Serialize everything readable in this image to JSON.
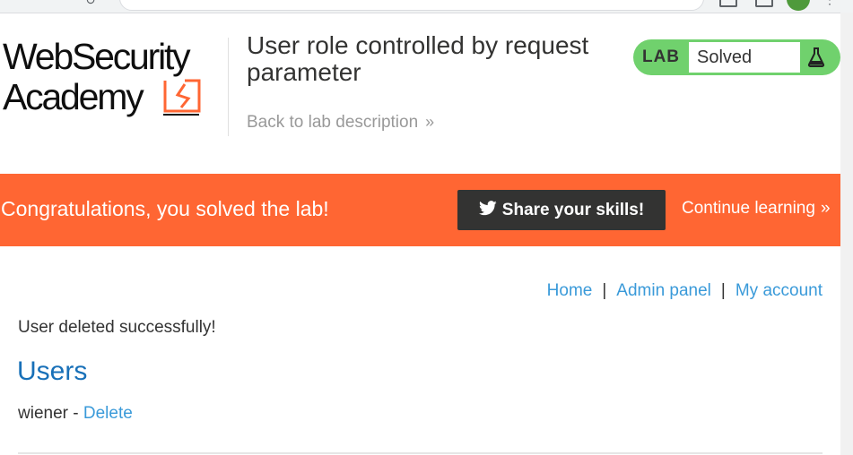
{
  "header": {
    "logo_line1": "WebSecurity",
    "logo_line2": "Academy",
    "lab_title": "User role controlled by request parameter",
    "back_link": "Back to lab description",
    "back_chevron": "»"
  },
  "status": {
    "badge": "LAB",
    "state": "Solved",
    "icon": "flask-icon",
    "color": "#70d16d"
  },
  "banner": {
    "message": "Congratulations, you solved the lab!",
    "share_button": "Share your skills!",
    "continue_link": "Continue learning",
    "continue_chevron": "»",
    "color": "#ff6633"
  },
  "nav": {
    "items": [
      "Home",
      "Admin panel",
      "My account"
    ],
    "separator": "|"
  },
  "main": {
    "message": "User deleted successfully!",
    "heading": "Users",
    "users": [
      {
        "name": "wiener",
        "separator": " - ",
        "action": "Delete"
      }
    ]
  }
}
